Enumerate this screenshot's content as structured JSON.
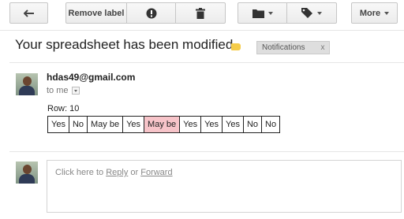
{
  "toolbar": {
    "back_icon": "back-arrow-icon",
    "remove_label": "Remove label",
    "report_icon": "report-spam-icon",
    "delete_icon": "trash-icon",
    "move_icon": "folder-icon",
    "labels_icon": "label-tag-icon",
    "more_label": "More"
  },
  "message": {
    "subject": "Your spreadsheet has been modified",
    "label_chip": "Notifications",
    "label_remove": "x",
    "importance_color": "#f5cc4a",
    "sender": "hdas49@gmail.com",
    "recipient": "to me",
    "row_label": "Row:  10",
    "answers": [
      "Yes",
      "No",
      "May be",
      "Yes",
      "May be",
      "Yes",
      "Yes",
      "Yes",
      "No",
      "No"
    ],
    "highlight_color": "#f7c4c9"
  },
  "reply": {
    "prefix": "Click here to ",
    "reply_link": "Reply",
    "or_text": " or ",
    "forward_link": "Forward"
  }
}
